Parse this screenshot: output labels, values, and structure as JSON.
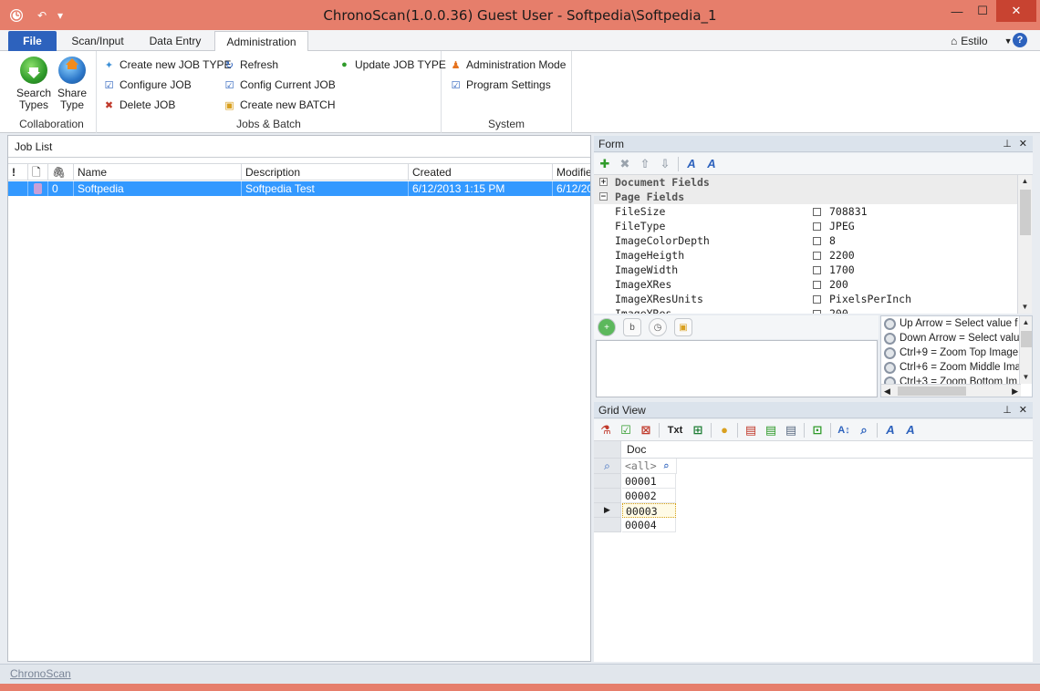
{
  "window": {
    "title": "ChronoScan(1.0.0.36) Guest User  - Softpedia\\Softpedia_1",
    "minimize": "—",
    "maximize": "☐",
    "close": "✕"
  },
  "ribbon": {
    "tabs": [
      "File",
      "Scan/Input",
      "Data Entry",
      "Administration"
    ],
    "style_label": "Estilo",
    "help": "?",
    "collaboration": {
      "label": "Collaboration",
      "search_types": "Search Types",
      "share_type": "Share Type"
    },
    "jobs_batch": {
      "label": "Jobs & Batch",
      "create_job_type": "Create new JOB TYPE",
      "configure_job": "Configure JOB",
      "delete_job": "Delete JOB",
      "refresh": "Refresh",
      "config_current_job": "Config Current JOB",
      "create_batch": "Create new BATCH",
      "update_job_type": "Update JOB TYPE"
    },
    "system": {
      "label": "System",
      "admin_mode": "Administration Mode",
      "program_settings": "Program Settings"
    }
  },
  "job_list": {
    "title": "Job List",
    "columns": [
      "!",
      "",
      "",
      "Name",
      "Description",
      "Created",
      "Modified"
    ],
    "rows": [
      {
        "count": "0",
        "name": "Softpedia",
        "description": "Softpedia Test",
        "created": "6/12/2013 1:15 PM",
        "modified": "6/12/20"
      }
    ]
  },
  "form": {
    "title": "Form",
    "categories": [
      "Document Fields",
      "Page Fields"
    ],
    "fields": [
      {
        "key": "FileSize",
        "value": "708831"
      },
      {
        "key": "FileType",
        "value": "JPEG"
      },
      {
        "key": "ImageColorDepth",
        "value": "8"
      },
      {
        "key": "ImageHeigth",
        "value": "2200"
      },
      {
        "key": "ImageWidth",
        "value": "1700"
      },
      {
        "key": "ImageXRes",
        "value": "200"
      },
      {
        "key": "ImageXResUnits",
        "value": "PixelsPerInch"
      },
      {
        "key": "ImageYRes",
        "value": "200"
      }
    ]
  },
  "shortcuts": [
    "Up Arrow  = Select value f",
    "Down Arrow = Select valu",
    "Ctrl+9 = Zoom Top Image",
    "Ctrl+6 = Zoom Middle Ima",
    "Ctrl+3 = Zoom Bottom Im"
  ],
  "grid_view": {
    "title": "Grid View",
    "column": "Doc",
    "filter": "<all>",
    "rows": [
      "00001",
      "00002",
      "00003",
      "00004"
    ],
    "txt_label": "Txt"
  },
  "status": {
    "text": "ChronoScan"
  },
  "colors": {
    "titlebar": "#e67e6b",
    "accent": "#2d62bd",
    "selection": "#3399ff"
  }
}
